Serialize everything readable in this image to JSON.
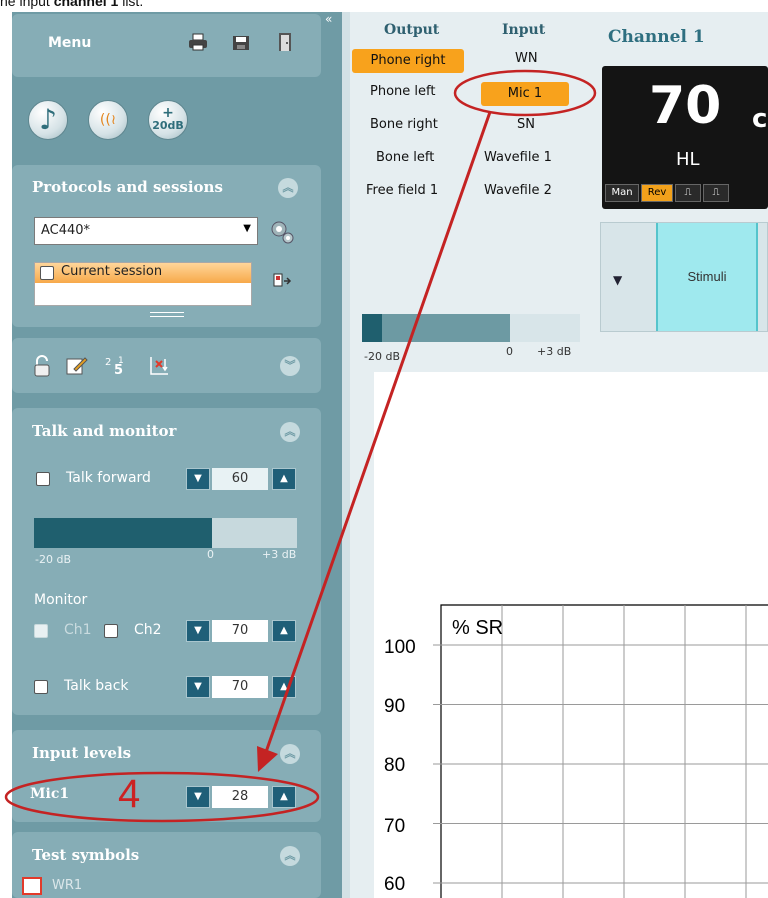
{
  "caption": {
    "prefix": "he input ",
    "bold": "channel 1",
    "suffix": " list."
  },
  "menu": {
    "title": "Menu",
    "icons": [
      "printer-icon",
      "save-icon",
      "exit-door-icon"
    ]
  },
  "round_buttons": [
    {
      "name": "music-note-icon",
      "glyph": "♪"
    },
    {
      "name": "talk-over-icon",
      "glyph": "((≀"
    },
    {
      "name": "plus-20db-icon",
      "plus": "+",
      "label": "20dB"
    }
  ],
  "protocols": {
    "title": "Protocols and sessions",
    "selected_protocol": "AC440*",
    "session_item": "Current session"
  },
  "tools": {
    "icons": [
      "lock-icon",
      "edit-note-icon",
      "renumber-icon",
      "graph-adjust-icon"
    ]
  },
  "talk_monitor": {
    "title": "Talk and monitor",
    "talk_forward_label": "Talk forward",
    "talk_forward_value": "60",
    "meter_min": "-20 dB",
    "meter_zero": "0",
    "meter_max": "+3 dB",
    "meter_level_fraction": 0.78,
    "monitor_label": "Monitor",
    "ch1_label": "Ch1",
    "ch2_label": "Ch2",
    "monitor_value": "70",
    "talk_back_label": "Talk back",
    "talk_back_value": "70"
  },
  "input_levels": {
    "title": "Input levels",
    "mic_label": "Mic1",
    "mic_value": "28",
    "annotation": "4"
  },
  "test_symbols": {
    "title": "Test symbols",
    "first_symbol": "WR1"
  },
  "routing": {
    "output_header": "Output",
    "input_header": "Input",
    "outputs": [
      "Phone right",
      "Phone left",
      "Bone right",
      "Bone left",
      "Free field 1"
    ],
    "inputs": [
      "WN",
      "Mic 1",
      "SN",
      "Wavefile 1",
      "Wavefile 2"
    ],
    "selected_output": "Phone right",
    "selected_input": "Mic 1"
  },
  "channel": {
    "title": "Channel 1",
    "level": "70",
    "unit_partial": "c",
    "scale": "HL",
    "modes": [
      "Man",
      "Rev",
      "⎍",
      "⎍"
    ],
    "active_mode": "Rev",
    "stimuli_label": "Stimuli",
    "meter_min": "-20 dB",
    "meter_zero": "0",
    "meter_max": "+3 dB"
  },
  "chart_data": {
    "type": "line",
    "ylabel": "% SR",
    "yticks": [
      "100",
      "90",
      "80",
      "70",
      "60"
    ],
    "ylim": [
      60,
      100
    ],
    "grid": true,
    "series": []
  },
  "colors": {
    "sidebar": "#6f9ba5",
    "panel": "#86adb6",
    "selected": "#f8a21c",
    "stepper": "#1f5f78",
    "annotation": "#cc2222",
    "stimuli": "#9fe9ee"
  }
}
